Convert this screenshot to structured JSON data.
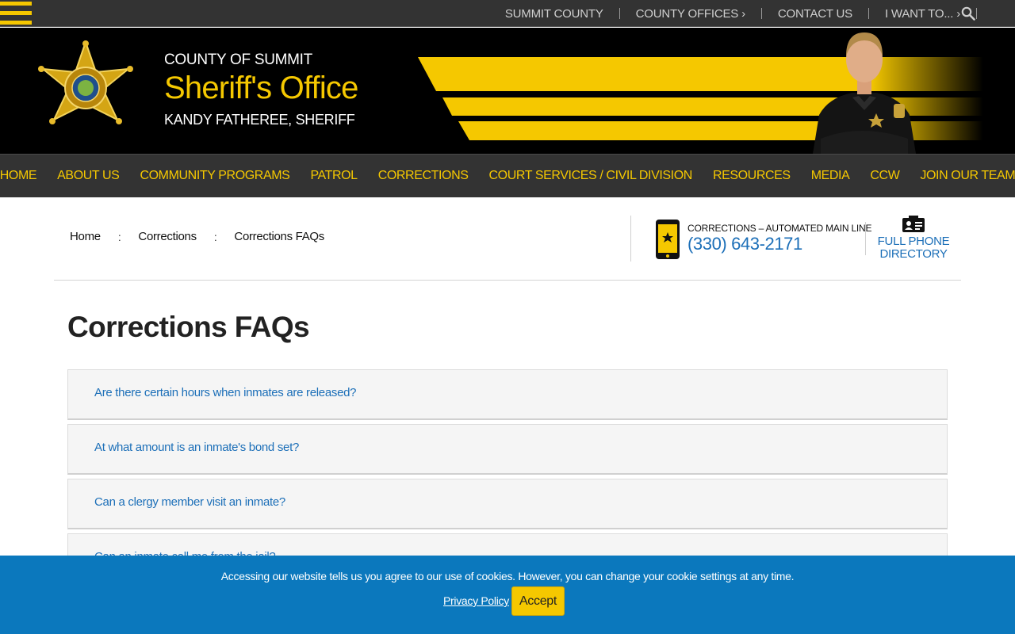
{
  "utility_nav": {
    "items": [
      "SUMMIT COUNTY",
      "COUNTY OFFICES ›",
      "CONTACT US",
      "I WANT TO... ›"
    ]
  },
  "brand": {
    "county": "COUNTY OF SUMMIT",
    "office": "Sheriff's Office",
    "sheriff": "KANDY FATHEREE, SHERIFF"
  },
  "main_nav": {
    "items": [
      "HOME",
      "ABOUT US",
      "COMMUNITY PROGRAMS",
      "PATROL",
      "CORRECTIONS",
      "COURT SERVICES / CIVIL DIVISION",
      "RESOURCES",
      "MEDIA",
      "CCW",
      "JOIN OUR TEAM"
    ]
  },
  "breadcrumb": {
    "items": [
      "Home",
      "Corrections",
      "Corrections FAQs"
    ],
    "separator": ":"
  },
  "contact": {
    "label": "CORRECTIONS – AUTOMATED MAIN LINE",
    "phone": "(330) 643-2171",
    "directory_line1": "FULL PHONE",
    "directory_line2": "DIRECTORY"
  },
  "page": {
    "title": "Corrections FAQs"
  },
  "faqs": [
    "Are there certain hours when inmates are released?",
    "At what amount is an inmate's bond set?",
    "Can a clergy member visit an inmate?",
    "Can an inmate call me from the jail?"
  ],
  "cookie": {
    "message": "Accessing our website tells us you agree to our use of cookies. However, you can change your cookie settings at any time.",
    "privacy": "Privacy Policy",
    "accept": "Accept"
  },
  "colors": {
    "accent_yellow": "#f5c800",
    "dark_bar": "#333333",
    "link_blue": "#1c6fb8",
    "cookie_blue": "#0b78bd"
  }
}
